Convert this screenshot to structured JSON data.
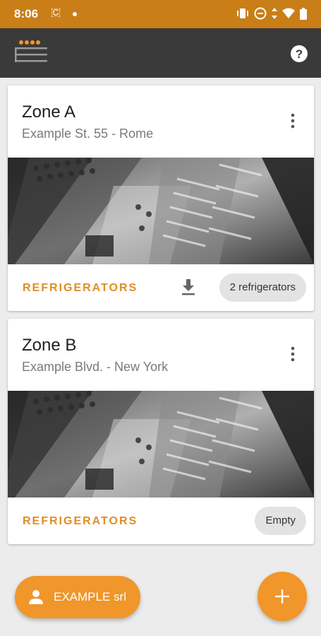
{
  "status_bar": {
    "time": "8:06",
    "left_icons": [
      "do-not-disturb-c-icon",
      "dot-icon"
    ],
    "right_icons": [
      "vibrate-icon",
      "do-not-disturb-icon",
      "data-icon",
      "wifi-icon",
      "battery-icon"
    ]
  },
  "app_bar": {
    "menu_icon": "menu-icon",
    "help_icon": "help-icon"
  },
  "colors": {
    "status_bar": "#c97e18",
    "app_bar": "#3a3a3a",
    "accent": "#f0962a",
    "section_label": "#e08d25",
    "background": "#ececec"
  },
  "zones": [
    {
      "name": "Zone A",
      "address": "Example St. 55 - Rome",
      "section_label": "REFRIGERATORS",
      "has_download": true,
      "chip": "2 refrigerators"
    },
    {
      "name": "Zone B",
      "address": "Example Blvd. - New York",
      "section_label": "REFRIGERATORS",
      "has_download": false,
      "chip": "Empty"
    }
  ],
  "company_button": {
    "label": "EXAMPLE srl",
    "icon": "person-icon"
  },
  "add_button": {
    "icon": "plus-icon"
  }
}
